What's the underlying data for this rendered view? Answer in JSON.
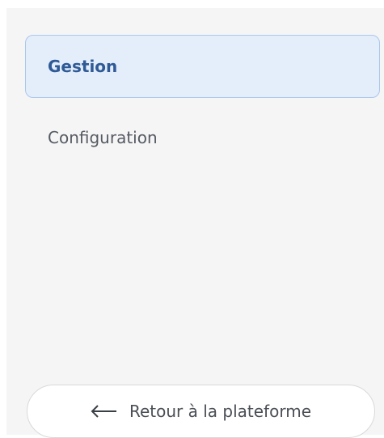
{
  "sidebar": {
    "items": [
      {
        "label": "Gestion",
        "active": true
      },
      {
        "label": "Configuration",
        "active": false
      }
    ],
    "back_button": {
      "label": "Retour à la plateforme",
      "icon": "arrow-left-icon"
    }
  },
  "colors": {
    "active_background": "#e4eefb",
    "active_border": "#aac6ec",
    "active_text": "#2f5a96",
    "sidebar_background": "#f5f5f5"
  }
}
